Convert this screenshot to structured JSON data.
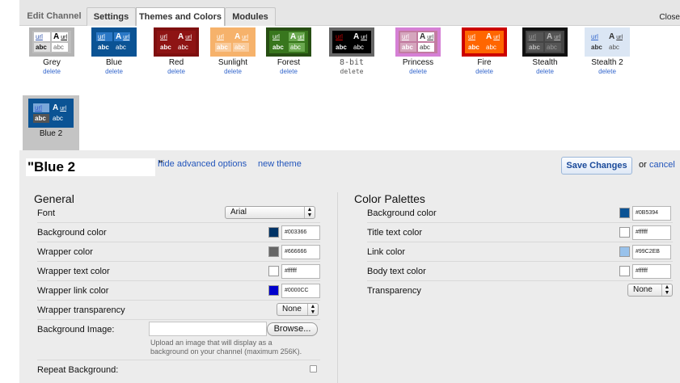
{
  "tabs": [
    {
      "label": "Edit Channel"
    },
    {
      "label": "Settings"
    },
    {
      "label": "Themes and Colors"
    },
    {
      "label": "Modules"
    }
  ],
  "close_label": "Close",
  "swatch_text": {
    "url": "url",
    "a": "A",
    "abc": "abc"
  },
  "themes": [
    {
      "name": "Grey",
      "delete": "delete",
      "colors": {
        "border": "#b3b3b3",
        "bg": "#bdbdbd",
        "c1": "#ffffff",
        "c2": "#ffffff",
        "c3": "#e0e0e0",
        "c4": "#ffffff",
        "t1": "#3355aa",
        "t2": "#000000",
        "t3": "#111111",
        "t4": "#666666"
      }
    },
    {
      "name": "Blue",
      "delete": "delete",
      "colors": {
        "border": "#0b5394",
        "bg": "#0b5394",
        "c1": "#2b78c6",
        "c2": "#2b78c6",
        "c3": "#0b5394",
        "c4": "#0b5394",
        "t1": "#ffffff",
        "t2": "#ffffff",
        "t3": "#ffffff",
        "t4": "#ffffff"
      }
    },
    {
      "name": "Red",
      "delete": "delete",
      "colors": {
        "border": "#7f1010",
        "bg": "#8e1414",
        "c1": "#8e1414",
        "c2": "#8e1414",
        "c3": "#8e1414",
        "c4": "#8e1414",
        "t1": "#ffffff",
        "t2": "#ffffff",
        "t3": "#ffffff",
        "t4": "#ffffff"
      }
    },
    {
      "name": "Sunlight",
      "delete": "delete",
      "colors": {
        "border": "#f6b26b",
        "bg": "#f6b26b",
        "c1": "#f6b26b",
        "c2": "#f6b26b",
        "c3": "#f9cb9c",
        "c4": "#f9cb9c",
        "t1": "#ffffff",
        "t2": "#ffffff",
        "t3": "#ffffff",
        "t4": "#ffffff"
      }
    },
    {
      "name": "Forest",
      "delete": "delete",
      "colors": {
        "border": "#274e13",
        "bg": "#38761d",
        "c1": "#38761d",
        "c2": "#6aa84f",
        "c3": "#38761d",
        "c4": "#6aa84f",
        "t1": "#ffffff",
        "t2": "#ffffff",
        "t3": "#ffffff",
        "t4": "#ffffff"
      }
    },
    {
      "name": "8-bit",
      "delete": "delete",
      "colors": {
        "border": "#666666",
        "bg": "#000000",
        "c1": "#000000",
        "c2": "#000000",
        "c3": "#000000",
        "c4": "#000000",
        "t1": "#cc0000",
        "t2": "#ffffff",
        "t3": "#ffffff",
        "t4": "#ffffff"
      }
    },
    {
      "name": "Princess",
      "delete": "delete",
      "colors": {
        "border": "#d580d5",
        "bg": "#c27ba0",
        "c1": "#d5a6bd",
        "c2": "#ffffff",
        "c3": "#d5a6bd",
        "c4": "#ffffff",
        "t1": "#ffffff",
        "t2": "#333333",
        "t3": "#ffffff",
        "t4": "#333333"
      }
    },
    {
      "name": "Fire",
      "delete": "delete",
      "colors": {
        "border": "#cc0000",
        "bg": "#ff6600",
        "c1": "#ff6600",
        "c2": "#ff6600",
        "c3": "#ff6600",
        "c4": "#ff6600",
        "t1": "#ffffff",
        "t2": "#ffffff",
        "t3": "#ffffff",
        "t4": "#ffffff"
      }
    },
    {
      "name": "Stealth",
      "delete": "delete",
      "colors": {
        "border": "#111111",
        "bg": "#444444",
        "c1": "#555555",
        "c2": "#555555",
        "c3": "#555555",
        "c4": "#555555",
        "t1": "#999999",
        "t2": "#bbbbbb",
        "t3": "#bbbbbb",
        "t4": "#999999"
      }
    },
    {
      "name": "Stealth 2",
      "delete": "delete",
      "colors": {
        "border": "#dbe6f4",
        "bg": "#dbe6f4",
        "c1": "#dbe6f4",
        "c2": "#dbe6f4",
        "c3": "#dbe6f4",
        "c4": "#dbe6f4",
        "t1": "#3366cc",
        "t2": "#333333",
        "t3": "#333333",
        "t4": "#555555"
      }
    },
    {
      "name": "Blue 2",
      "selected": true,
      "colors": {
        "border": "#0b5394",
        "bg": "#0b5394",
        "c1": "#7aa7d9",
        "c2": "#0b5394",
        "c3": "#555555",
        "c4": "#0b5394",
        "t1": "#3355cc",
        "t2": "#ffffff",
        "t3": "#ffffff",
        "t4": "#ffffff"
      }
    }
  ],
  "title_bar": {
    "theme_title": "\"Blue 2",
    "quote_end": "\"",
    "hide_advanced": "hide advanced options",
    "new_theme": "new theme",
    "save": "Save Changes",
    "or": "or",
    "cancel": "cancel"
  },
  "general": {
    "title": "General",
    "font": {
      "label": "Font",
      "value": "Arial"
    },
    "background_color": {
      "label": "Background color",
      "hex": "#003366",
      "swatch": "#003366"
    },
    "wrapper_color": {
      "label": "Wrapper color",
      "hex": "#666666",
      "swatch": "#666666"
    },
    "wrapper_text_color": {
      "label": "Wrapper text color",
      "hex": "#ffffff",
      "swatch": "#ffffff"
    },
    "wrapper_link_color": {
      "label": "Wrapper link color",
      "hex": "#0000CC",
      "swatch": "#0000CC"
    },
    "wrapper_transparency": {
      "label": "Wrapper transparency",
      "value": "None"
    },
    "background_image": {
      "label": "Background Image:",
      "browse": "Browse...",
      "help": "Upload an image that will display as a background on your channel (maximum 256K)."
    },
    "repeat_background": {
      "label": "Repeat Background:",
      "checked": false
    }
  },
  "palettes": {
    "title": "Color Palettes",
    "background_color": {
      "label": "Background color",
      "hex": "#0B5394",
      "swatch": "#0B5394"
    },
    "title_text_color": {
      "label": "Title text color",
      "hex": "#ffffff",
      "swatch": "#ffffff"
    },
    "link_color": {
      "label": "Link color",
      "hex": "#99C2EB",
      "swatch": "#99C2EB"
    },
    "body_text_color": {
      "label": "Body text color",
      "hex": "#ffffff",
      "swatch": "#ffffff"
    },
    "transparency": {
      "label": "Transparency",
      "value": "None"
    }
  }
}
